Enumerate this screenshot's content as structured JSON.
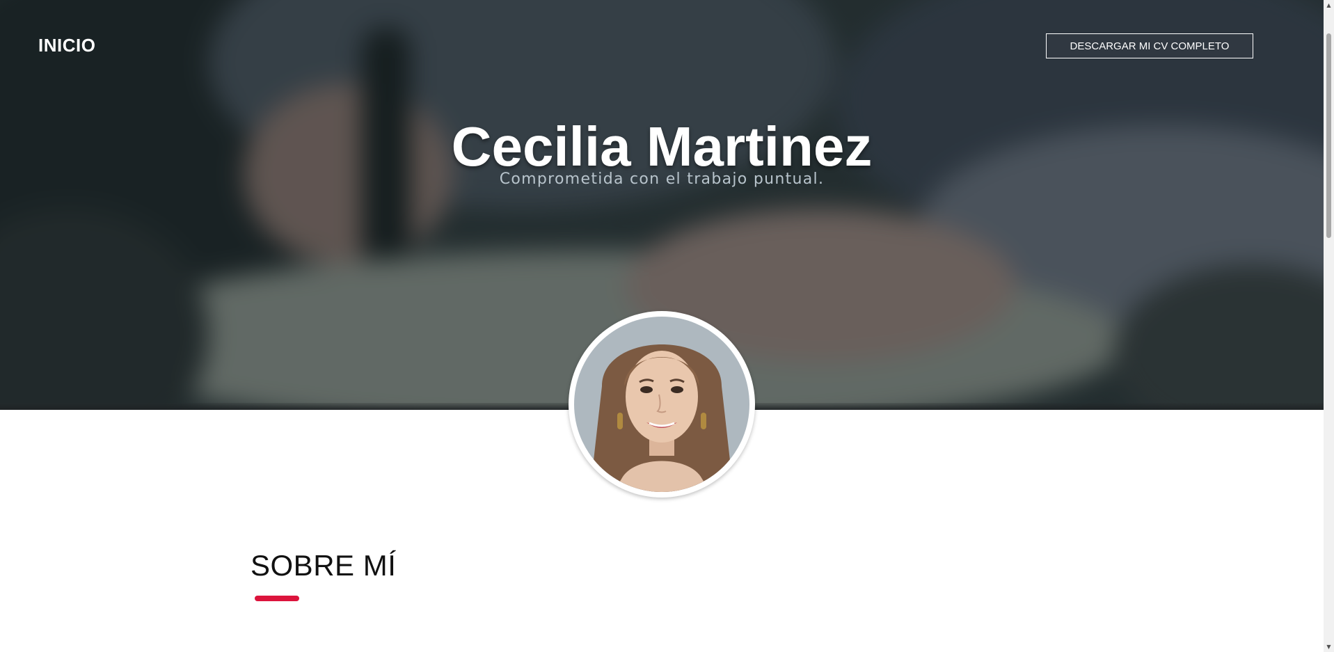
{
  "nav": {
    "brand": "INICIO",
    "cv_button": "DESCARGAR MI CV COMPLETO"
  },
  "hero": {
    "name": "Cecilia Martinez",
    "tagline": "Comprometida con el trabajo puntual."
  },
  "profile": {
    "photo_icon": "profile-photo"
  },
  "about": {
    "heading": "SOBRE MÍ"
  },
  "colors": {
    "accent": "#dc143c",
    "hero_text": "#ffffff",
    "tagline": "#b8c4cc"
  },
  "icons": {
    "scroll_up": "scroll-up-arrow-icon",
    "scroll_down": "scroll-down-arrow-icon"
  }
}
